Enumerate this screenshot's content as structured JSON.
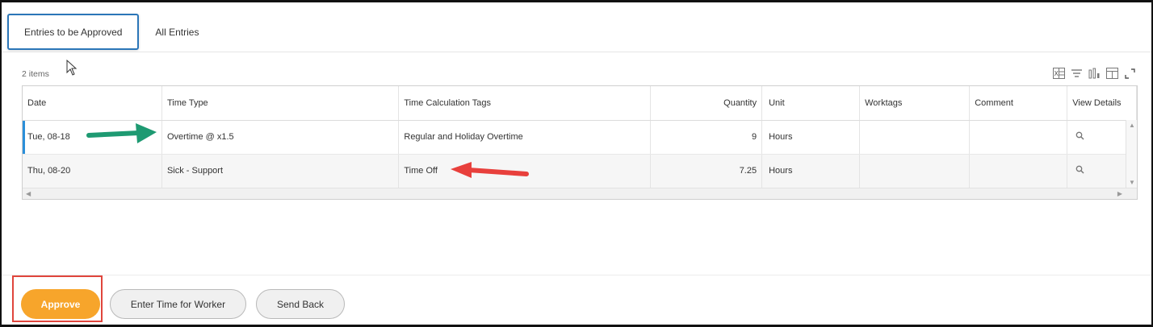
{
  "tabs": [
    {
      "label": "Entries to be Approved",
      "active": true
    },
    {
      "label": "All Entries",
      "active": false
    }
  ],
  "grid": {
    "count_label": "2 items",
    "columns": [
      "Date",
      "Time Type",
      "Time Calculation Tags",
      "Quantity",
      "Unit",
      "Worktags",
      "Comment",
      "View Details"
    ],
    "rows": [
      {
        "date": "Tue, 08-18",
        "time_type": "Overtime @ x1.5",
        "tags": "Regular and Holiday Overtime",
        "quantity": "9",
        "unit": "Hours",
        "worktags": "",
        "comment": ""
      },
      {
        "date": "Thu, 08-20",
        "time_type": "Sick - Support",
        "tags": "Time Off",
        "quantity": "7.25",
        "unit": "Hours",
        "worktags": "",
        "comment": ""
      }
    ],
    "toolbar_icons": [
      "excel-export-icon",
      "filter-icon",
      "chart-icon",
      "table-view-icon",
      "fullscreen-icon"
    ]
  },
  "actions": {
    "approve": "Approve",
    "enter_time": "Enter Time for Worker",
    "send_back": "Send Back"
  },
  "colors": {
    "primary_button": "#f7a52b",
    "active_tab_border": "#2b76b8",
    "highlight_box": "#e0453c",
    "green_arrow": "#1e9a72",
    "red_arrow": "#e8403c"
  }
}
